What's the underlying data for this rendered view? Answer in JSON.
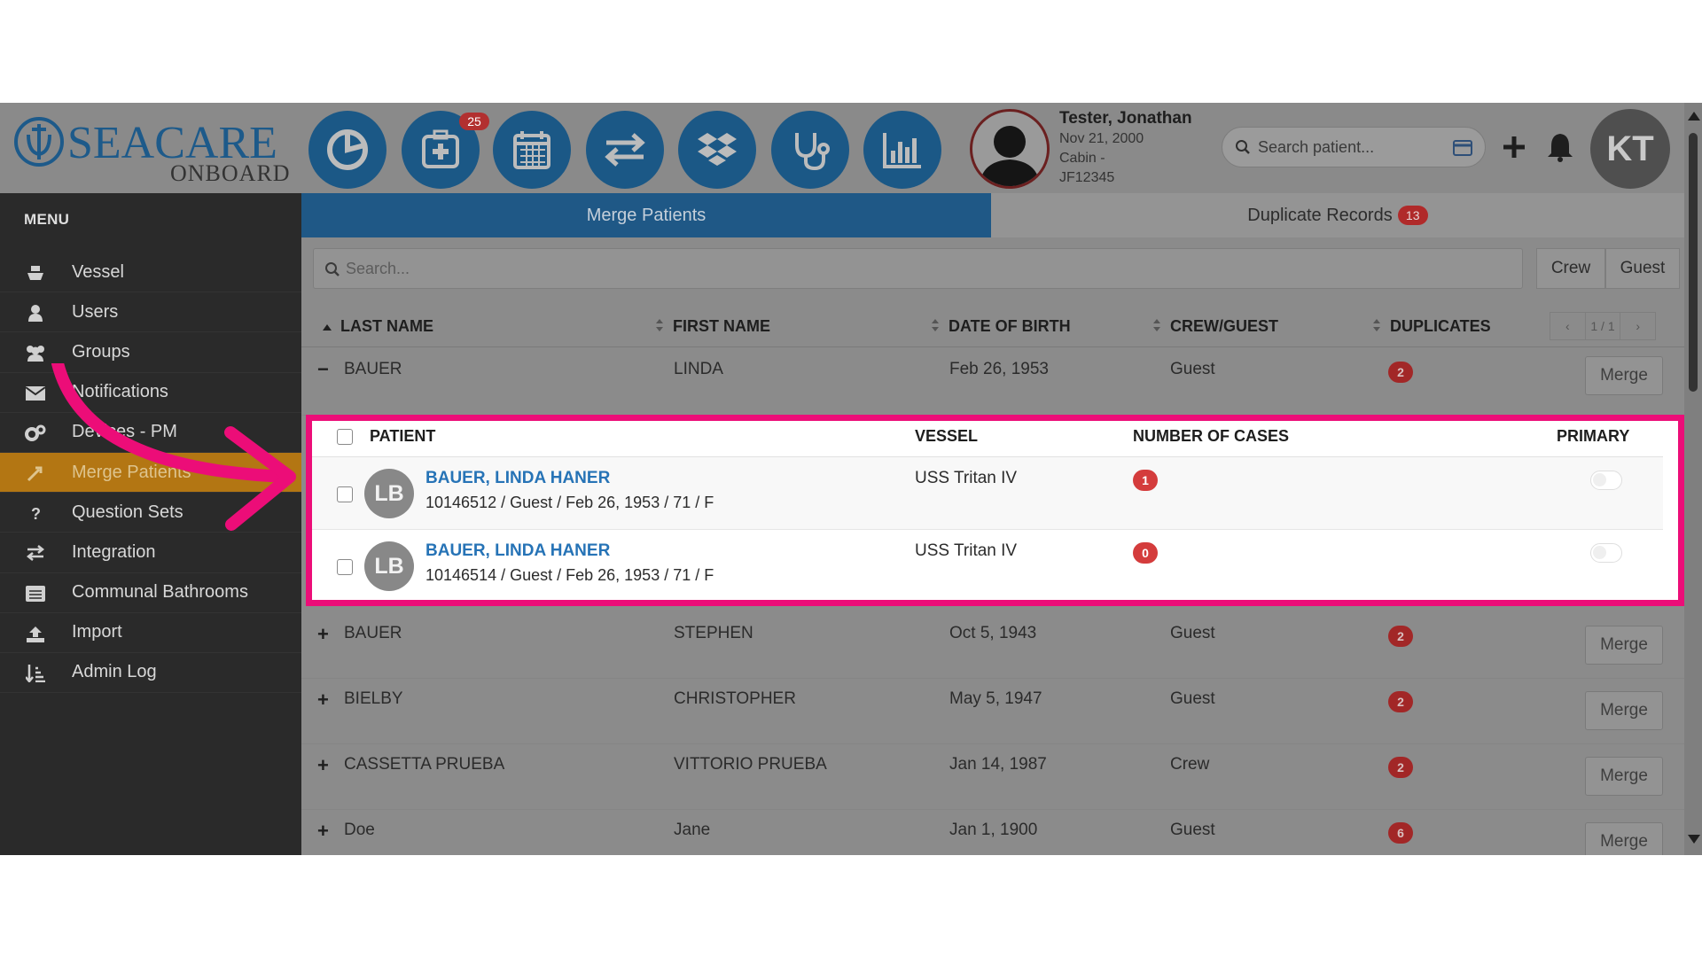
{
  "header": {
    "logo": {
      "brand": "SEACARE",
      "sub": "ONBOARD"
    },
    "nav_icons": [
      "dashboard-pie-icon",
      "medical-plus-icon",
      "calendar-icon",
      "transfer-arrows-icon",
      "dropbox-icon",
      "stethoscope-icon",
      "bar-chart-icon"
    ],
    "nav_badge": "25",
    "patient": {
      "name": "Tester, Jonathan",
      "dob": "Nov 21, 2000",
      "cabin": "Cabin -",
      "id": "JF12345"
    },
    "search_placeholder": "Search patient...",
    "user_initials": "KT"
  },
  "sidebar": {
    "title": "MENU",
    "items": [
      {
        "label": "Vessel",
        "icon": "ship-icon"
      },
      {
        "label": "Users",
        "icon": "user-icon"
      },
      {
        "label": "Groups",
        "icon": "group-icon"
      },
      {
        "label": "Notifications",
        "icon": "envelope-icon"
      },
      {
        "label": "Devices - PM",
        "icon": "gears-icon"
      },
      {
        "label": "Merge Patients",
        "icon": "merge-icon",
        "active": true
      },
      {
        "label": "Question Sets",
        "icon": "question-icon"
      },
      {
        "label": "Integration",
        "icon": "exchange-icon"
      },
      {
        "label": "Communal Bathrooms",
        "icon": "list-alt-icon"
      },
      {
        "label": "Import",
        "icon": "upload-icon"
      },
      {
        "label": "Admin Log",
        "icon": "sort-amount-icon"
      }
    ]
  },
  "tabs": {
    "merge": "Merge Patients",
    "duplicates": "Duplicate Records",
    "duplicates_count": "13"
  },
  "filter": {
    "search_placeholder": "Search...",
    "crew": "Crew",
    "guest": "Guest"
  },
  "table": {
    "headers": {
      "last_name": "LAST NAME",
      "first_name": "FIRST NAME",
      "dob": "DATE OF BIRTH",
      "crew_guest": "CREW/GUEST",
      "duplicates": "DUPLICATES"
    },
    "pager": {
      "prev": "‹",
      "page": "1 / 1",
      "next": "›"
    },
    "merge_label": "Merge",
    "rows": [
      {
        "toggle": "−",
        "last": "BAUER",
        "first": "LINDA",
        "dob": "Feb 26, 1953",
        "type": "Guest",
        "dups": "2"
      },
      {
        "toggle": "+",
        "last": "BAUER",
        "first": "STEPHEN",
        "dob": "Oct 5, 1943",
        "type": "Guest",
        "dups": "2"
      },
      {
        "toggle": "+",
        "last": "BIELBY",
        "first": "CHRISTOPHER",
        "dob": "May 5, 1947",
        "type": "Guest",
        "dups": "2"
      },
      {
        "toggle": "+",
        "last": "CASSETTA PRUEBA",
        "first": "VITTORIO PRUEBA",
        "dob": "Jan 14, 1987",
        "type": "Crew",
        "dups": "2"
      },
      {
        "toggle": "+",
        "last": "Doe",
        "first": "Jane",
        "dob": "Jan 1, 1900",
        "type": "Guest",
        "dups": "6"
      }
    ]
  },
  "expanded": {
    "headers": {
      "patient": "PATIENT",
      "vessel": "VESSEL",
      "cases": "NUMBER OF CASES",
      "primary": "PRIMARY"
    },
    "records": [
      {
        "initials": "LB",
        "name": "BAUER, LINDA HANER",
        "info": "10146512 / Guest / Feb 26, 1953 / 71 / F",
        "vessel": "USS Tritan IV",
        "cases": "1"
      },
      {
        "initials": "LB",
        "name": "BAUER, LINDA HANER",
        "info": "10146514 / Guest / Feb 26, 1953 / 71 / F",
        "vessel": "USS Tritan IV",
        "cases": "0"
      }
    ]
  },
  "colors": {
    "nav_blue": "#1b5886",
    "active_menu": "#b37613",
    "badge_red": "#b02a2a",
    "highlight_pink": "#ec0d78",
    "link_blue": "#2673b6"
  }
}
